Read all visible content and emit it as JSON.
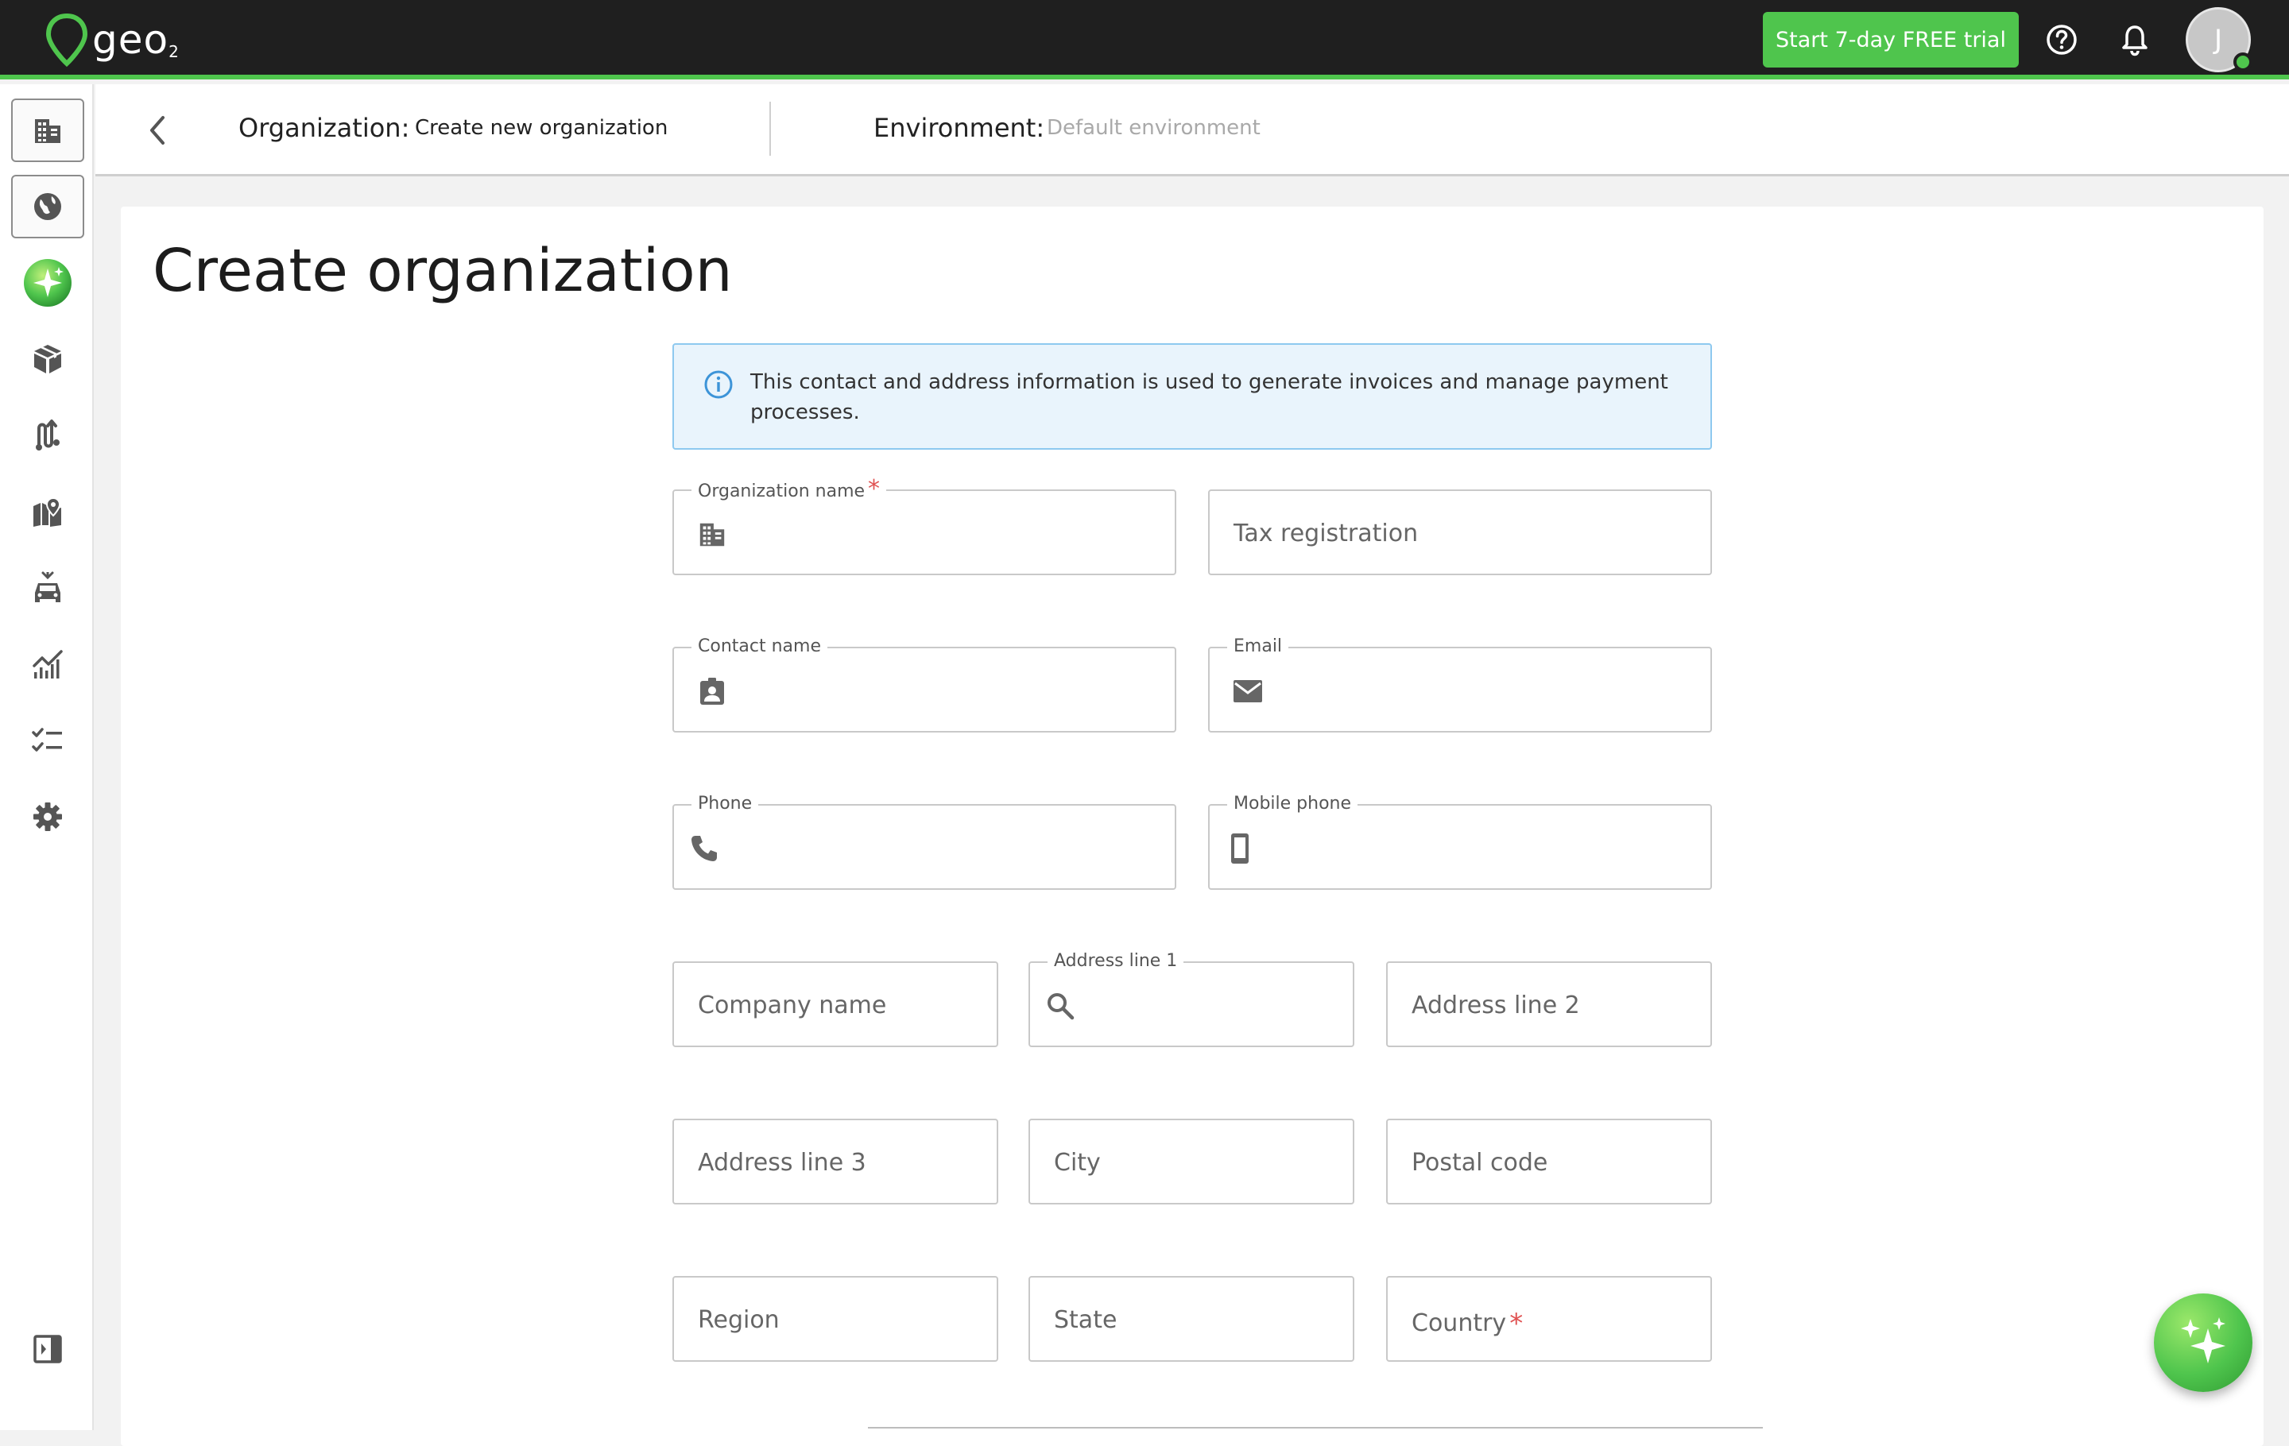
{
  "app": {
    "logo_text": "geo",
    "logo_sub": "2",
    "trial_button": "Start 7-day FREE trial",
    "avatar_initial": "J",
    "accent": "#4fc54d"
  },
  "sidebar": {
    "items": [
      {
        "icon": "building-icon",
        "boxed": true
      },
      {
        "icon": "globe-icon",
        "boxed": true
      },
      {
        "icon": "sparkle-gradient-icon",
        "boxed": false
      },
      {
        "icon": "package-icon",
        "boxed": false
      },
      {
        "icon": "route-icon",
        "boxed": false
      },
      {
        "icon": "map-pin-icon",
        "boxed": false
      },
      {
        "icon": "vehicle-icon",
        "boxed": false
      },
      {
        "icon": "analytics-icon",
        "boxed": false
      },
      {
        "icon": "checklist-icon",
        "boxed": false
      },
      {
        "icon": "gear-icon",
        "boxed": false
      }
    ],
    "collapse_icon": "sidebar-collapse-icon"
  },
  "header": {
    "organization_label": "Organization:",
    "organization_value": "Create new organization",
    "environment_label": "Environment:",
    "environment_value": "Default environment"
  },
  "main": {
    "title": "Create organization",
    "info_text": "This contact and address information is used to generate invoices and manage payment processes.",
    "fields": {
      "organization_name": {
        "label": "Organization name",
        "required": "*",
        "value": ""
      },
      "tax_registration": {
        "placeholder": "Tax registration"
      },
      "contact_name": {
        "label": "Contact name",
        "value": ""
      },
      "email": {
        "label": "Email",
        "value": ""
      },
      "phone": {
        "label": "Phone",
        "value": ""
      },
      "mobile_phone": {
        "label": "Mobile phone",
        "value": ""
      },
      "company_name": {
        "placeholder": "Company name"
      },
      "address_line_1": {
        "label": "Address line 1",
        "value": ""
      },
      "address_line_2": {
        "placeholder": "Address line 2"
      },
      "address_line_3": {
        "placeholder": "Address line 3"
      },
      "city": {
        "placeholder": "City"
      },
      "postal_code": {
        "placeholder": "Postal code"
      },
      "region": {
        "placeholder": "Region"
      },
      "state": {
        "placeholder": "State"
      },
      "country": {
        "placeholder": "Country",
        "required": "*"
      }
    }
  }
}
